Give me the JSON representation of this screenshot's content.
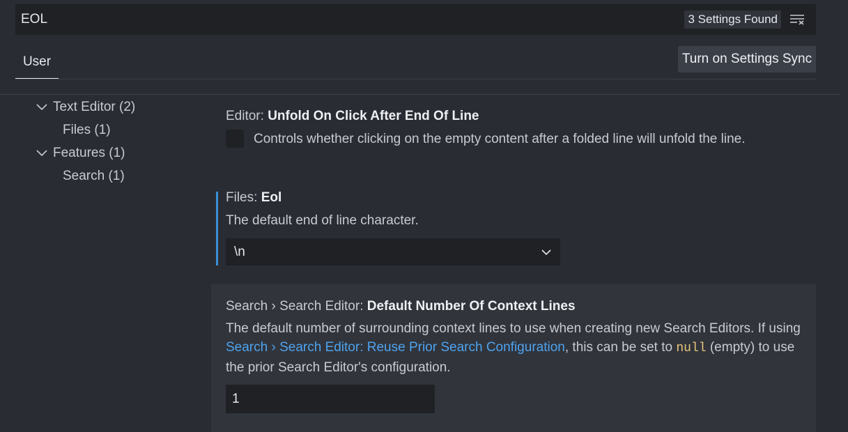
{
  "search": {
    "value": "EOL",
    "results_badge": "3 Settings Found",
    "clear_icon": "clear-filter-icon"
  },
  "tabs": [
    {
      "label": "User"
    }
  ],
  "sync_button_label": "Turn on Settings Sync",
  "toc": [
    {
      "label": "Text Editor (2)",
      "expanded": true
    },
    {
      "label": "Files (1)"
    },
    {
      "label": "Features (1)",
      "expanded": true
    },
    {
      "label": "Search (1)"
    }
  ],
  "settings": {
    "unfold": {
      "category": "Editor: ",
      "name": "Unfold On Click After End Of Line",
      "description": "Controls whether clicking on the empty content after a folded line will unfold the line.",
      "checked": false
    },
    "eol": {
      "category": "Files: ",
      "name": "Eol",
      "description": "The default end of line character.",
      "value": "\\n",
      "modified_indicator_color": "#3a8fd6"
    },
    "context_lines": {
      "category": "Search › Search Editor: ",
      "name": "Default Number Of Context Lines",
      "desc_part1": "The default number of surrounding context lines to use when creating new Search Editors. If using ",
      "link_text": "Search › Search Editor: Reuse Prior Search Configuration",
      "desc_part2": ", this can be set to ",
      "code_text": "null",
      "desc_part3": " (empty) to use the prior Search Editor's configuration.",
      "value": "1"
    }
  },
  "colors": {
    "background": "#292c33",
    "input_background": "#1f2125",
    "link": "#4da3f0",
    "focused_row": "#31343b"
  }
}
